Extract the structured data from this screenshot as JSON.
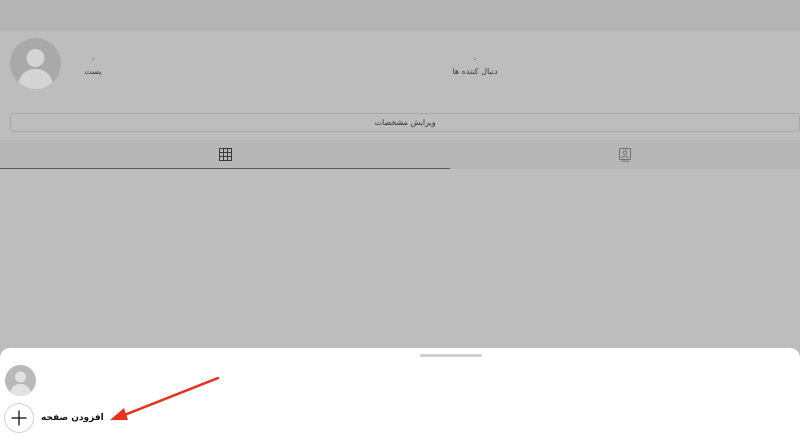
{
  "profile": {
    "posts_count": "۰",
    "posts_label": "پست",
    "followers_count": "۰",
    "followers_label": "دنبال کننده ها",
    "edit_button_label": "ویرایش مشخصات"
  },
  "tabs": [
    {
      "icon": "grid-icon",
      "active": true
    },
    {
      "icon": "tagged-icon",
      "active": false
    }
  ],
  "sheet": {
    "add_page_label": "افزودن صفحه"
  },
  "colors": {
    "overlay": "#bdbdbd",
    "sheet": "#ffffff",
    "annotation_arrow": "#e8321e"
  }
}
